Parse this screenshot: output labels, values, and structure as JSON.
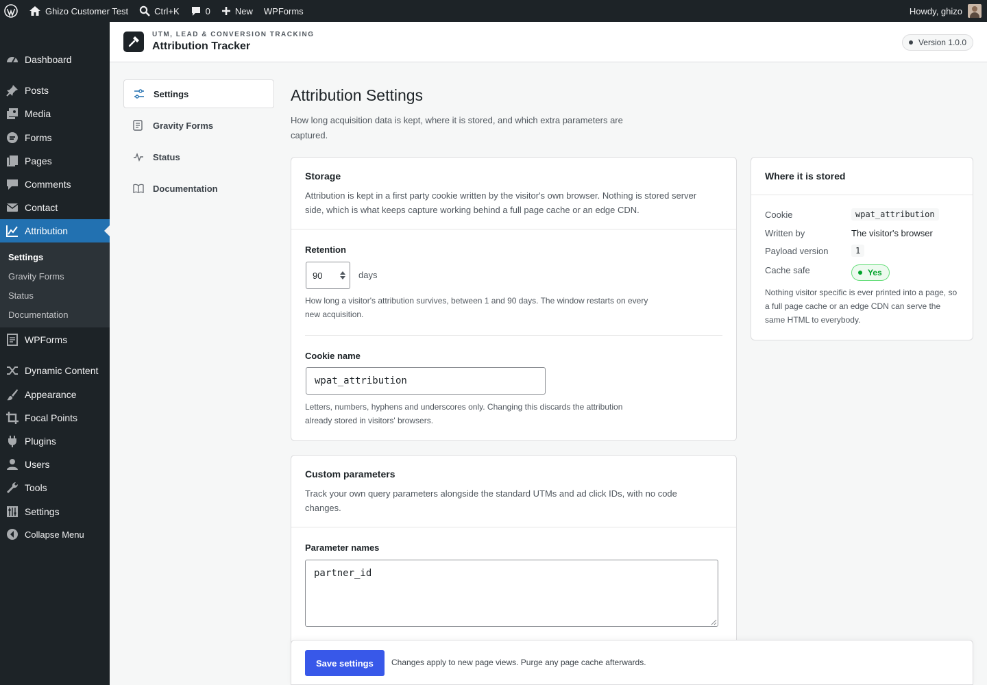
{
  "adminbar": {
    "site_name": "Ghizo Customer Test",
    "search_shortcut": "Ctrl+K",
    "comments_count": "0",
    "new_label": "New",
    "wpforms_label": "WPForms",
    "greeting": "Howdy, ghizo"
  },
  "sidebar": {
    "items": [
      {
        "label": "Dashboard",
        "icon": "dashboard-icon"
      },
      {
        "label": "Posts",
        "icon": "pin-icon"
      },
      {
        "label": "Media",
        "icon": "media-icon"
      },
      {
        "label": "Forms",
        "icon": "forms-icon"
      },
      {
        "label": "Pages",
        "icon": "pages-icon"
      },
      {
        "label": "Comments",
        "icon": "comment-icon"
      },
      {
        "label": "Contact",
        "icon": "mail-icon"
      },
      {
        "label": "Attribution",
        "icon": "chart-line-icon"
      },
      {
        "label": "WPForms",
        "icon": "wpforms-icon"
      },
      {
        "label": "Dynamic Content",
        "icon": "shuffle-icon"
      },
      {
        "label": "Appearance",
        "icon": "brush-icon"
      },
      {
        "label": "Focal Points",
        "icon": "crop-icon"
      },
      {
        "label": "Plugins",
        "icon": "plugin-icon"
      },
      {
        "label": "Users",
        "icon": "user-icon"
      },
      {
        "label": "Tools",
        "icon": "wrench-icon"
      },
      {
        "label": "Settings",
        "icon": "sliders-icon"
      },
      {
        "label": "Collapse Menu",
        "icon": "collapse-icon"
      }
    ],
    "submenu": [
      "Settings",
      "Gravity Forms",
      "Status",
      "Documentation"
    ]
  },
  "header": {
    "eyebrow": "UTM, LEAD & CONVERSION TRACKING",
    "title": "Attribution Tracker",
    "version": "Version 1.0.0"
  },
  "subnav": [
    {
      "label": "Settings",
      "icon": "sliders-icon"
    },
    {
      "label": "Gravity Forms",
      "icon": "document-icon"
    },
    {
      "label": "Status",
      "icon": "pulse-icon"
    },
    {
      "label": "Documentation",
      "icon": "book-icon"
    }
  ],
  "main": {
    "title": "Attribution Settings",
    "description": "How long acquisition data is kept, where it is stored, and which extra parameters are captured."
  },
  "storage": {
    "title": "Storage",
    "description": "Attribution is kept in a first party cookie written by the visitor's own browser. Nothing is stored server side, which is what keeps capture working behind a full page cache or an edge CDN.",
    "retention_label": "Retention",
    "retention_value": "90",
    "retention_unit": "days",
    "retention_help": "How long a visitor's attribution survives, between 1 and 90 days. The window restarts on every new acquisition.",
    "cookie_label": "Cookie name",
    "cookie_value": "wpat_attribution",
    "cookie_help": "Letters, numbers, hyphens and underscores only. Changing this discards the attribution already stored in visitors' browsers."
  },
  "custom_params": {
    "title": "Custom parameters",
    "description": "Track your own query parameters alongside the standard UTMs and ad click IDs, with no code changes.",
    "names_label": "Parameter names",
    "names_value": "partner_id"
  },
  "stored": {
    "title": "Where it is stored",
    "rows": [
      {
        "label": "Cookie",
        "value": "wpat_attribution"
      },
      {
        "label": "Written by",
        "value": "The visitor's browser"
      },
      {
        "label": "Payload version",
        "value": "1"
      },
      {
        "label": "Cache safe",
        "value": "Yes"
      }
    ],
    "note": "Nothing visitor specific is ever printed into a page, so a full page cache or an edge CDN can serve the same HTML to everybody."
  },
  "savebar": {
    "button": "Save settings",
    "note": "Changes apply to new page views. Purge any page cache afterwards."
  },
  "colors": {
    "admin_dark": "#1d2327",
    "accent_blue": "#2271b1",
    "save_button": "#3858e9",
    "success_green": "#00a32a"
  }
}
